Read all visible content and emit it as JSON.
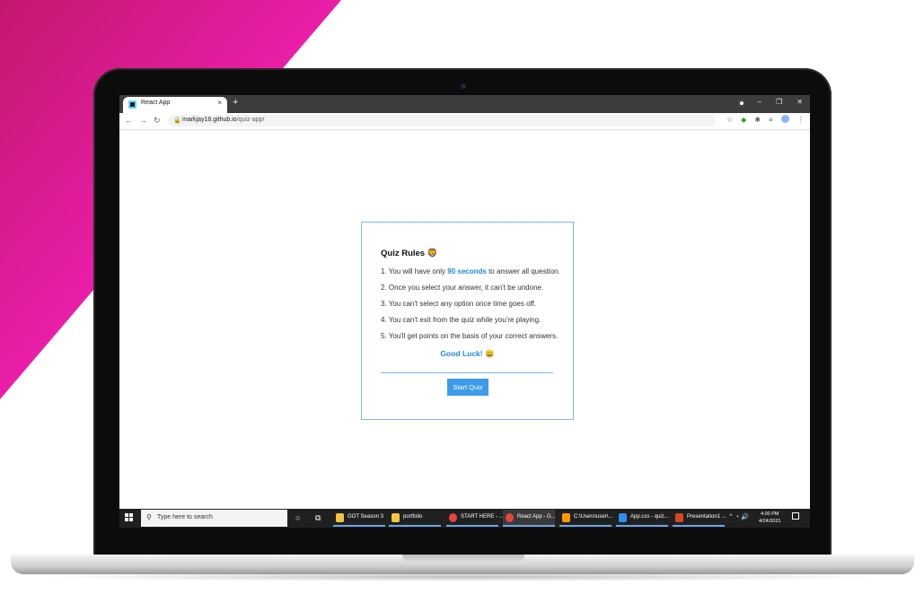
{
  "browser": {
    "tab_title": "React App",
    "tab_close": "×",
    "new_tab": "+",
    "url_host": "markjay18.github.io",
    "url_path": "/quiz-app/",
    "window_controls": [
      "–",
      "❐",
      "✕"
    ]
  },
  "quiz": {
    "title": "Quiz Rules",
    "title_emoji": "🦁",
    "rules": [
      {
        "prefix": "1. You will have only ",
        "highlight": "90 seconds",
        "suffix": " to answer all question."
      },
      {
        "text": "2. Once you select your answer, it can't be undone."
      },
      {
        "text": "3. You can't select any option once time goes off."
      },
      {
        "text": "4. You can't exit from the quiz while you're playing."
      },
      {
        "text": "5. You'll get points on the basis of your correct answers."
      }
    ],
    "good_luck": "Good Luck!",
    "good_luck_emoji": "😀",
    "start_button": "Start Quiz"
  },
  "taskbar": {
    "search_placeholder": "Type here to search",
    "apps": [
      {
        "label": "GOT Season 3",
        "icon_color": "#f4c542"
      },
      {
        "label": "portfolio",
        "icon_color": "#f4c542"
      },
      {
        "label": "START HERE - ...",
        "icon_color": "#e8453c"
      },
      {
        "label": "React App - G...",
        "icon_color": "#e8453c"
      },
      {
        "label": "C:\\Users\\user\\...",
        "icon_color": "#ff9800"
      },
      {
        "label": "App.css - quiz...",
        "icon_color": "#2f8fe8"
      },
      {
        "label": "Presentation1 ...",
        "icon_color": "#d24726"
      }
    ],
    "time": "4:00 PM",
    "date": "4/24/2021"
  },
  "colors": {
    "accent": "#1e88e5",
    "button": "#3d9be9",
    "card_border": "#7cb7ea",
    "magenta": "#e91e9a"
  }
}
